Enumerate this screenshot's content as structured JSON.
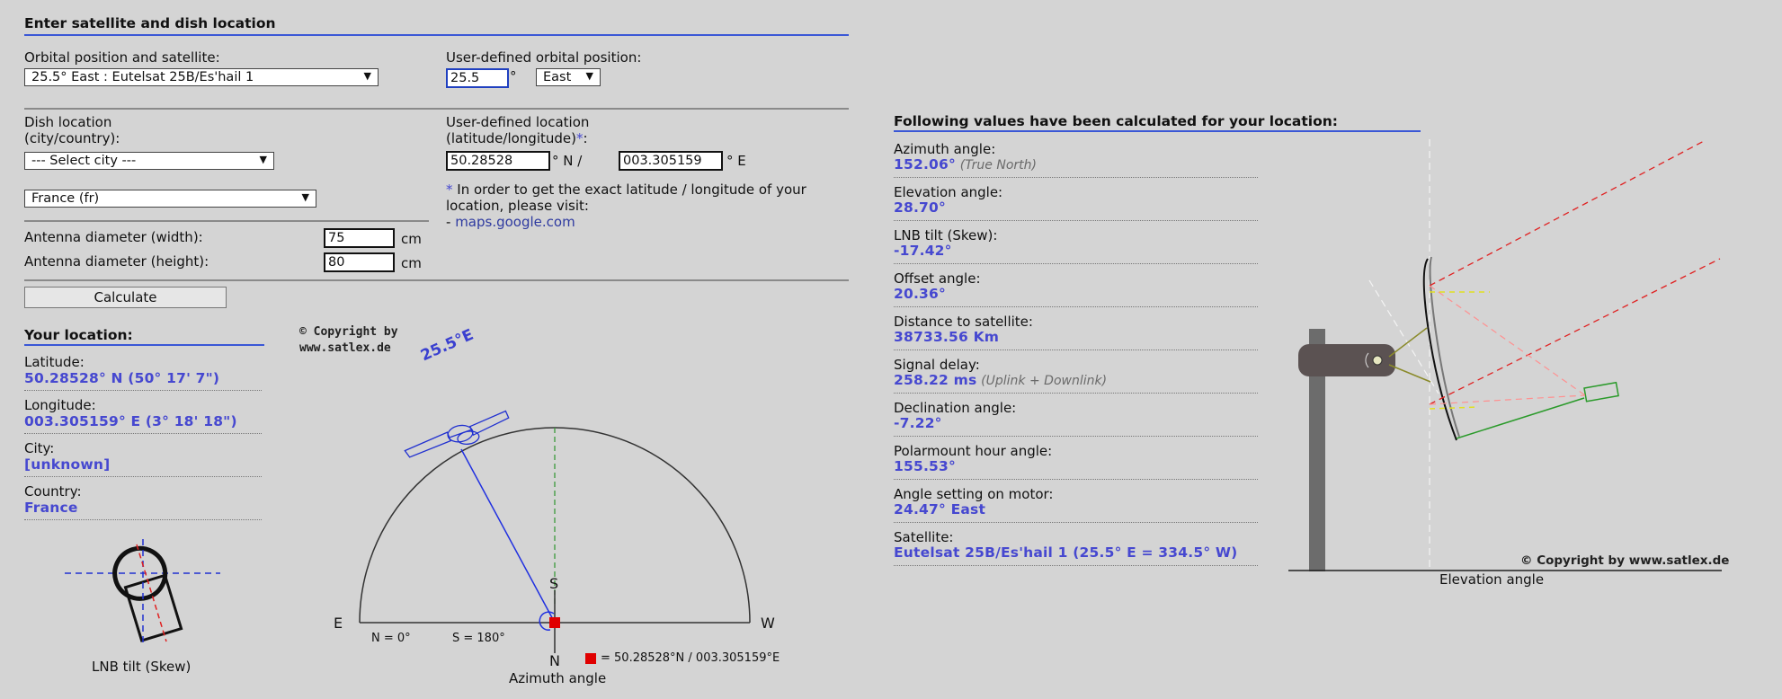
{
  "header": {
    "title": "Enter satellite and dish location"
  },
  "orbital": {
    "label": "Orbital position and satellite:",
    "selected": "25.5° East : Eutelsat 25B/Es'hail 1",
    "user_label": "User-defined orbital position:",
    "user_value": "25.5",
    "degree_symbol": "°",
    "direction": "East"
  },
  "dish": {
    "label_line1": "Dish location",
    "label_line2": "(city/country):",
    "city_selected": "--- Select city ---",
    "country_selected": "France (fr)",
    "user_label_line1": "User-defined location",
    "user_label_line2": "(latitude/longitude)",
    "asterisk": "*",
    "colon": ":",
    "latitude": "50.28528",
    "lat_suffix": "° N /",
    "longitude": "003.305159",
    "lon_suffix": "° E",
    "note_line1": "In order to get the exact latitude / longitude of your",
    "note_line2": "location, please visit:",
    "note_link_prefix": "- ",
    "note_link": "maps.google.com"
  },
  "antenna": {
    "width_label": "Antenna diameter (width):",
    "width_value": "75",
    "height_label": "Antenna diameter (height):",
    "height_value": "80",
    "unit": "cm"
  },
  "calculate_label": "Calculate",
  "your_location": {
    "title": "Your location:",
    "items": [
      {
        "label": "Latitude:",
        "value": "50.28528° N (50° 17' 7\")"
      },
      {
        "label": "Longitude:",
        "value": "003.305159° E (3° 18' 18\")"
      },
      {
        "label": "City:",
        "value": "[unknown]"
      },
      {
        "label": "Country:",
        "value": "France"
      }
    ]
  },
  "skew_caption": "LNB tilt (Skew)",
  "azimuth_diagram": {
    "copyright_line1": "© Copyright by",
    "copyright_line2": "www.satlex.de",
    "sat_label": "25.5°E",
    "E": "E",
    "W": "W",
    "S": "S",
    "N": "N",
    "n0": "N = 0°",
    "s180": "S = 180°",
    "legend": "= 50.28528°N / 003.305159°E",
    "caption": "Azimuth angle"
  },
  "results": {
    "title": "Following values have been calculated for your location:",
    "items": [
      {
        "label": "Azimuth angle:",
        "value": "152.06°",
        "note": "(True North)"
      },
      {
        "label": "Elevation angle:",
        "value": "28.70°",
        "note": ""
      },
      {
        "label": "LNB tilt (Skew):",
        "value": "-17.42°",
        "note": ""
      },
      {
        "label": "Offset angle:",
        "value": "20.36°",
        "note": ""
      },
      {
        "label": "Distance to satellite:",
        "value": "38733.56 Km",
        "note": ""
      },
      {
        "label": "Signal delay:",
        "value": "258.22 ms",
        "note": "(Uplink + Downlink)"
      },
      {
        "label": "Declination angle:",
        "value": "-7.22°",
        "note": ""
      },
      {
        "label": "Polarmount hour angle:",
        "value": "155.53°",
        "note": ""
      },
      {
        "label": "Angle setting on motor:",
        "value": "24.47° East",
        "note": ""
      },
      {
        "label": "Satellite:",
        "value": "Eutelsat 25B/Es'hail 1 (25.5° E = 334.5° W)",
        "note": ""
      }
    ]
  },
  "elevation_diagram": {
    "copyright": "© Copyright by www.satlex.de",
    "caption": "Elevation angle"
  },
  "colors": {
    "accent_blue": "#3a57d6",
    "value_blue": "#4648d0",
    "marker_red": "#e00000"
  }
}
